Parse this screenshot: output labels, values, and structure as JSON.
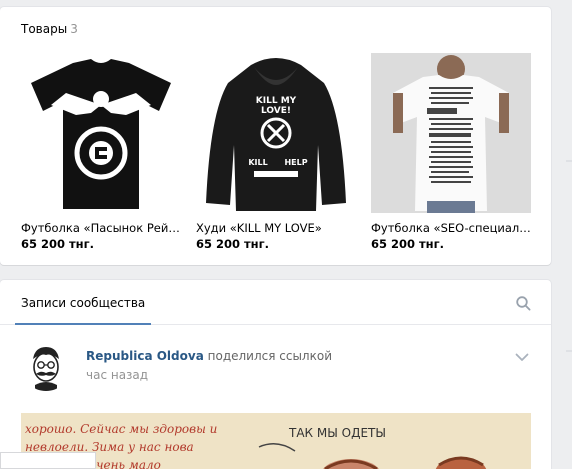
{
  "goods": {
    "title": "Товары",
    "count": "3",
    "items": [
      {
        "title": "Футболка «Пасынок Рейх…",
        "price": "65 200 тнг."
      },
      {
        "title": "Худи «KILL MY LOVE»",
        "price": "65 200 тнг."
      },
      {
        "title": "Футболка «SEO-специали…",
        "price": "65 200 тнг."
      }
    ]
  },
  "hoodie_print": {
    "line1": "KILL MY",
    "line2": "LOVE!",
    "line3": "KILL",
    "line4": "HELP"
  },
  "wall": {
    "tab": "Записи сообщества",
    "post": {
      "author": "Republica Oldova",
      "action": "поделился ссылкой",
      "time": "час назад"
    }
  },
  "photo_text": {
    "left1": "хорошо. Сейчас мы здоровы и",
    "left2": "невлоели. Зима у нас нова",
    "left3": "ая но очень мало",
    "right": "ТАК МЫ ОДЕТЫ"
  }
}
